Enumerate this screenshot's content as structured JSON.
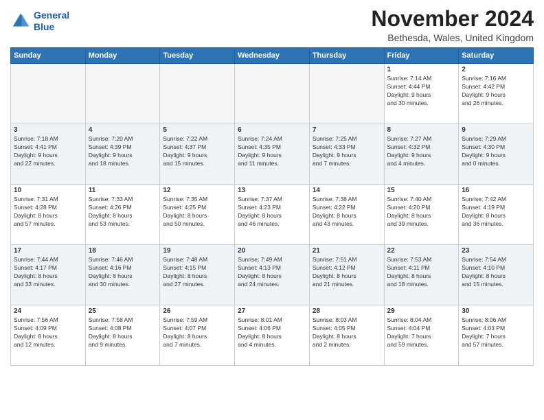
{
  "header": {
    "logo_line1": "General",
    "logo_line2": "Blue",
    "month_title": "November 2024",
    "location": "Bethesda, Wales, United Kingdom"
  },
  "days_of_week": [
    "Sunday",
    "Monday",
    "Tuesday",
    "Wednesday",
    "Thursday",
    "Friday",
    "Saturday"
  ],
  "weeks": [
    [
      {
        "day": "",
        "info": ""
      },
      {
        "day": "",
        "info": ""
      },
      {
        "day": "",
        "info": ""
      },
      {
        "day": "",
        "info": ""
      },
      {
        "day": "",
        "info": ""
      },
      {
        "day": "1",
        "info": "Sunrise: 7:14 AM\nSunset: 4:44 PM\nDaylight: 9 hours\nand 30 minutes."
      },
      {
        "day": "2",
        "info": "Sunrise: 7:16 AM\nSunset: 4:42 PM\nDaylight: 9 hours\nand 26 minutes."
      }
    ],
    [
      {
        "day": "3",
        "info": "Sunrise: 7:18 AM\nSunset: 4:41 PM\nDaylight: 9 hours\nand 22 minutes."
      },
      {
        "day": "4",
        "info": "Sunrise: 7:20 AM\nSunset: 4:39 PM\nDaylight: 9 hours\nand 18 minutes."
      },
      {
        "day": "5",
        "info": "Sunrise: 7:22 AM\nSunset: 4:37 PM\nDaylight: 9 hours\nand 15 minutes."
      },
      {
        "day": "6",
        "info": "Sunrise: 7:24 AM\nSunset: 4:35 PM\nDaylight: 9 hours\nand 11 minutes."
      },
      {
        "day": "7",
        "info": "Sunrise: 7:25 AM\nSunset: 4:33 PM\nDaylight: 9 hours\nand 7 minutes."
      },
      {
        "day": "8",
        "info": "Sunrise: 7:27 AM\nSunset: 4:32 PM\nDaylight: 9 hours\nand 4 minutes."
      },
      {
        "day": "9",
        "info": "Sunrise: 7:29 AM\nSunset: 4:30 PM\nDaylight: 9 hours\nand 0 minutes."
      }
    ],
    [
      {
        "day": "10",
        "info": "Sunrise: 7:31 AM\nSunset: 4:28 PM\nDaylight: 8 hours\nand 57 minutes."
      },
      {
        "day": "11",
        "info": "Sunrise: 7:33 AM\nSunset: 4:26 PM\nDaylight: 8 hours\nand 53 minutes."
      },
      {
        "day": "12",
        "info": "Sunrise: 7:35 AM\nSunset: 4:25 PM\nDaylight: 8 hours\nand 50 minutes."
      },
      {
        "day": "13",
        "info": "Sunrise: 7:37 AM\nSunset: 4:23 PM\nDaylight: 8 hours\nand 46 minutes."
      },
      {
        "day": "14",
        "info": "Sunrise: 7:38 AM\nSunset: 4:22 PM\nDaylight: 8 hours\nand 43 minutes."
      },
      {
        "day": "15",
        "info": "Sunrise: 7:40 AM\nSunset: 4:20 PM\nDaylight: 8 hours\nand 39 minutes."
      },
      {
        "day": "16",
        "info": "Sunrise: 7:42 AM\nSunset: 4:19 PM\nDaylight: 8 hours\nand 36 minutes."
      }
    ],
    [
      {
        "day": "17",
        "info": "Sunrise: 7:44 AM\nSunset: 4:17 PM\nDaylight: 8 hours\nand 33 minutes."
      },
      {
        "day": "18",
        "info": "Sunrise: 7:46 AM\nSunset: 4:16 PM\nDaylight: 8 hours\nand 30 minutes."
      },
      {
        "day": "19",
        "info": "Sunrise: 7:48 AM\nSunset: 4:15 PM\nDaylight: 8 hours\nand 27 minutes."
      },
      {
        "day": "20",
        "info": "Sunrise: 7:49 AM\nSunset: 4:13 PM\nDaylight: 8 hours\nand 24 minutes."
      },
      {
        "day": "21",
        "info": "Sunrise: 7:51 AM\nSunset: 4:12 PM\nDaylight: 8 hours\nand 21 minutes."
      },
      {
        "day": "22",
        "info": "Sunrise: 7:53 AM\nSunset: 4:11 PM\nDaylight: 8 hours\nand 18 minutes."
      },
      {
        "day": "23",
        "info": "Sunrise: 7:54 AM\nSunset: 4:10 PM\nDaylight: 8 hours\nand 15 minutes."
      }
    ],
    [
      {
        "day": "24",
        "info": "Sunrise: 7:56 AM\nSunset: 4:09 PM\nDaylight: 8 hours\nand 12 minutes."
      },
      {
        "day": "25",
        "info": "Sunrise: 7:58 AM\nSunset: 4:08 PM\nDaylight: 8 hours\nand 9 minutes."
      },
      {
        "day": "26",
        "info": "Sunrise: 7:59 AM\nSunset: 4:07 PM\nDaylight: 8 hours\nand 7 minutes."
      },
      {
        "day": "27",
        "info": "Sunrise: 8:01 AM\nSunset: 4:06 PM\nDaylight: 8 hours\nand 4 minutes."
      },
      {
        "day": "28",
        "info": "Sunrise: 8:03 AM\nSunset: 4:05 PM\nDaylight: 8 hours\nand 2 minutes."
      },
      {
        "day": "29",
        "info": "Sunrise: 8:04 AM\nSunset: 4:04 PM\nDaylight: 7 hours\nand 59 minutes."
      },
      {
        "day": "30",
        "info": "Sunrise: 8:06 AM\nSunset: 4:03 PM\nDaylight: 7 hours\nand 57 minutes."
      }
    ]
  ]
}
